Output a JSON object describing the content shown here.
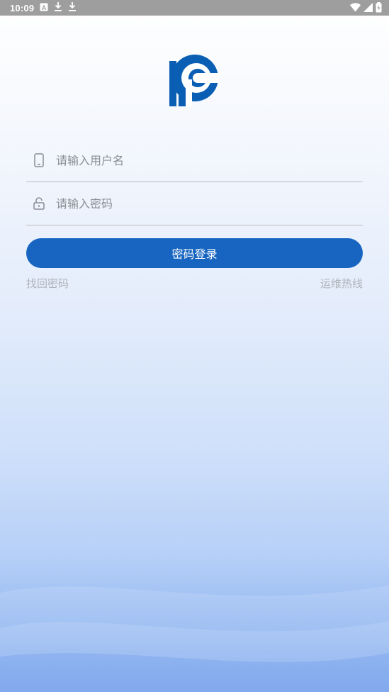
{
  "status_bar": {
    "time": "10:09",
    "left_icons": [
      "a-notification-icon",
      "download-icon",
      "download-icon"
    ],
    "right_icons": [
      "wifi-icon",
      "signal-icon",
      "battery-icon"
    ]
  },
  "brand": {
    "logo": "pc-logo",
    "color": "#0a5fb4"
  },
  "form": {
    "username_placeholder": "请输入用户名",
    "password_placeholder": "请输入密码",
    "username_icon": "phone-icon",
    "password_icon": "lock-icon"
  },
  "actions": {
    "login_label": "密码登录",
    "forgot_label": "找回密码",
    "hotline_label": "运维热线"
  },
  "colors": {
    "accent": "#1765c0",
    "link": "#b0b4bb"
  }
}
